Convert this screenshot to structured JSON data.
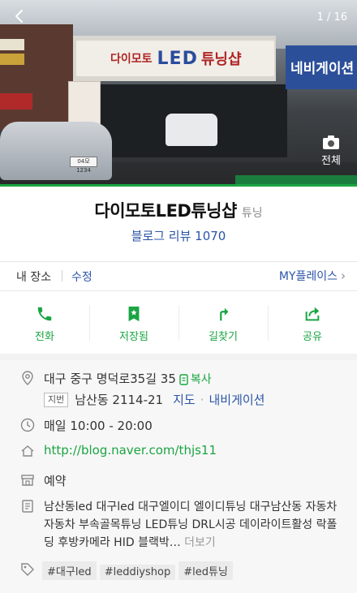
{
  "photo": {
    "counter": "1 / 16",
    "view_all_label": "전체",
    "sign_small_text": "다이모토",
    "sign_led_text": "LED",
    "sign_tuning_text": "튜닝샵",
    "right_sign_text": "네비게이션",
    "plate_text": "04모1234"
  },
  "place": {
    "name": "다이모토LED튜닝샵",
    "category": "튜닝",
    "review_label": "블로그 리뷰 1070"
  },
  "tabs": {
    "my_place_label": "내 장소",
    "edit_label": "수정",
    "myplaces_label": "MY플레이스"
  },
  "actions": [
    {
      "label": "전화",
      "icon": "phone-icon"
    },
    {
      "label": "저장됨",
      "icon": "bookmark-star-icon"
    },
    {
      "label": "길찾기",
      "icon": "directions-icon"
    },
    {
      "label": "공유",
      "icon": "share-icon"
    }
  ],
  "info": {
    "address": "대구 중구 명덕로35길 35",
    "copy_label": "복사",
    "jibun_badge": "지번",
    "jibun_address": "남산동 2114-21",
    "map_label": "지도",
    "navigation_label": "내비게이션",
    "hours": "매일 10:00 - 20:00",
    "website": "http://blog.naver.com/thjs11",
    "reservation_label": "예약",
    "description": "남산동led 대구led 대구엘이디 엘이디튜닝 대구남산동 자동차 자동차 부속골목튜닝 LED튜닝 DRL시공 데이라이트활성 락폴딩 후방카메라 HID 블랙박…",
    "more_label": "더보기",
    "tags": [
      "#대구led",
      "#leddiyshop",
      "#led튜닝"
    ]
  },
  "colors": {
    "accent_green": "#1aa542",
    "link_blue": "#2b55a6"
  }
}
